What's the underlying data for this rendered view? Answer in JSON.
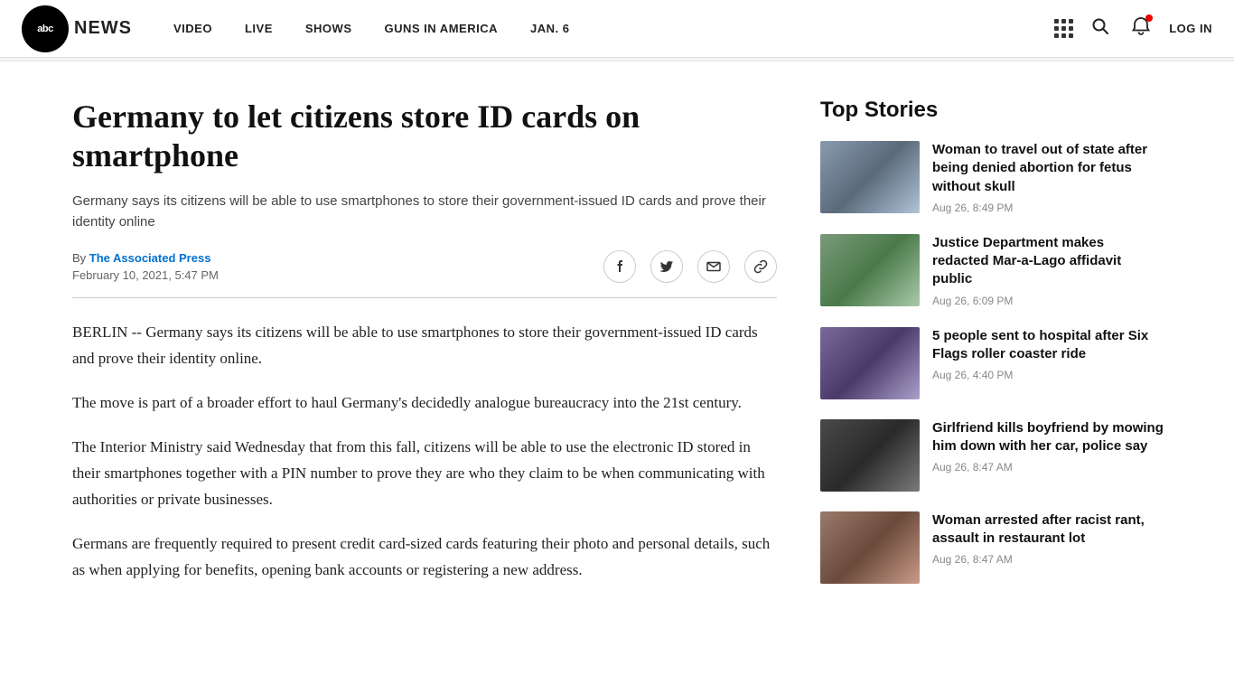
{
  "navbar": {
    "logo_text": "abc",
    "news_text": "NEWS",
    "links": [
      {
        "label": "VIDEO",
        "id": "video"
      },
      {
        "label": "LIVE",
        "id": "live"
      },
      {
        "label": "SHOWS",
        "id": "shows"
      },
      {
        "label": "GUNS IN AMERICA",
        "id": "guns"
      },
      {
        "label": "JAN. 6",
        "id": "jan6"
      }
    ],
    "login_label": "LOG IN"
  },
  "article": {
    "title": "Germany to let citizens store ID cards on smartphone",
    "subtitle": "Germany says its citizens will be able to use smartphones to store their government-issued ID cards and prove their identity online",
    "byline_prefix": "By",
    "author": "The Associated Press",
    "date": "February 10, 2021, 5:47 PM",
    "body_paragraphs": [
      "BERLIN -- Germany says its citizens will be able to use smartphones to store their government-issued ID cards and prove their identity online.",
      "The move is part of a broader effort to haul Germany's decidedly analogue bureaucracy into the 21st century.",
      "The Interior Ministry said Wednesday that from this fall, citizens will be able to use the electronic ID stored in their smartphones together with a PIN number to prove they are who they claim to be when communicating with authorities or private businesses.",
      "Germans are frequently required to present credit card-sized cards featuring their photo and personal details, such as when applying for benefits, opening bank accounts or registering a new address."
    ]
  },
  "sidebar": {
    "top_stories_label": "Top Stories",
    "stories": [
      {
        "headline": "Woman to travel out of state after being denied abortion for fetus without skull",
        "time": "Aug 26, 8:49 PM",
        "thumb_class": "thumb-1"
      },
      {
        "headline": "Justice Department makes redacted Mar-a-Lago affidavit public",
        "time": "Aug 26, 6:09 PM",
        "thumb_class": "thumb-2"
      },
      {
        "headline": "5 people sent to hospital after Six Flags roller coaster ride",
        "time": "Aug 26, 4:40 PM",
        "thumb_class": "thumb-3"
      },
      {
        "headline": "Girlfriend kills boyfriend by mowing him down with her car, police say",
        "time": "Aug 26, 8:47 AM",
        "thumb_class": "thumb-4"
      },
      {
        "headline": "Woman arrested after racist rant, assault in restaurant lot",
        "time": "Aug 26, 8:47 AM",
        "thumb_class": "thumb-5"
      }
    ]
  },
  "icons": {
    "facebook": "f",
    "twitter": "t",
    "email": "✉",
    "link": "🔗"
  }
}
